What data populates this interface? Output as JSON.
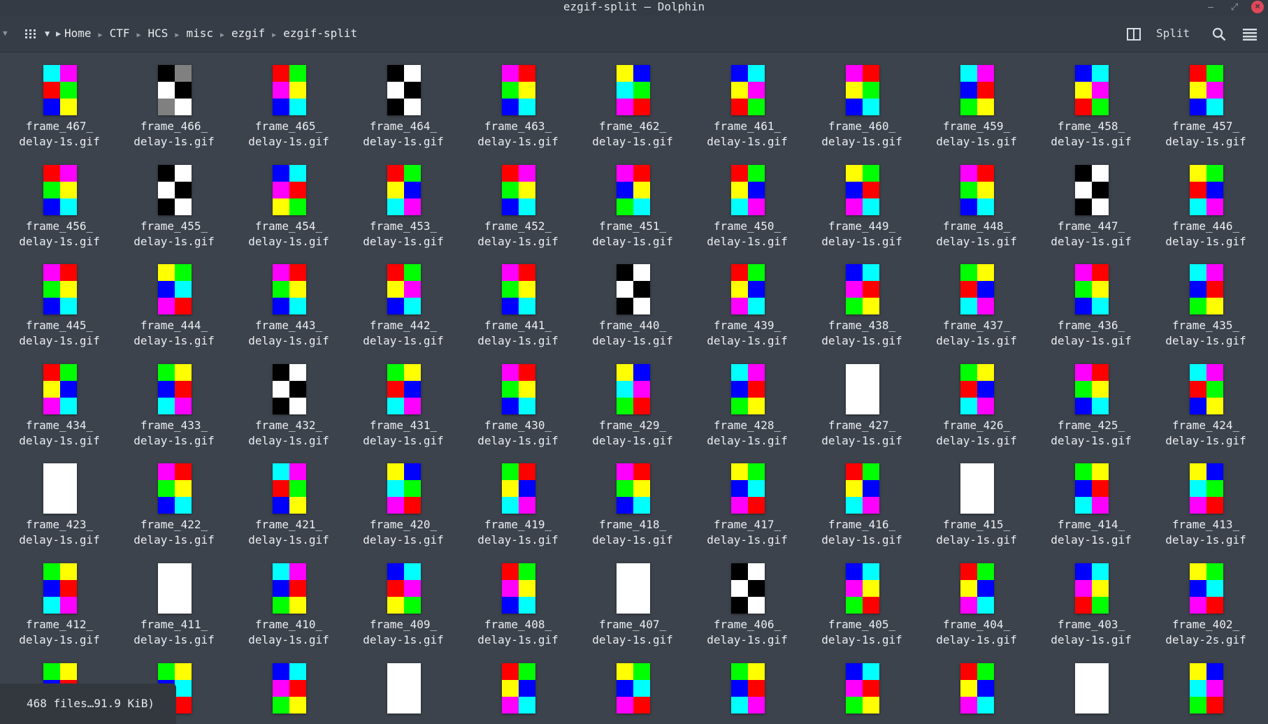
{
  "window": {
    "title": "ezgif-split — Dolphin"
  },
  "toolbar": {
    "breadcrumb": [
      "Home",
      "CTF",
      "HCS",
      "misc",
      "ezgif",
      "ezgif-split"
    ],
    "split_label": "Split"
  },
  "colors": {
    "R": "#ff0000",
    "G": "#00ff00",
    "B": "#0000ff",
    "Y": "#ffff00",
    "C": "#00ffff",
    "M": "#ff00ff",
    "K": "#000000",
    "W": "#ffffff",
    "E": "#808080"
  },
  "files": [
    {
      "l1": "frame_467_",
      "l2": "delay-1s.gif",
      "c": "CMRGBY"
    },
    {
      "l1": "frame_466_",
      "l2": "delay-1s.gif",
      "c": "KEWKEW"
    },
    {
      "l1": "frame_465_",
      "l2": "delay-1s.gif",
      "c": "RGMYBC"
    },
    {
      "l1": "frame_464_",
      "l2": "delay-1s.gif",
      "c": "KWWKKW"
    },
    {
      "l1": "frame_463_",
      "l2": "delay-1s.gif",
      "c": "MRGYBC"
    },
    {
      "l1": "frame_462_",
      "l2": "delay-1s.gif",
      "c": "YBCGMR"
    },
    {
      "l1": "frame_461_",
      "l2": "delay-1s.gif",
      "c": "BCYMRG"
    },
    {
      "l1": "frame_460_",
      "l2": "delay-1s.gif",
      "c": "MRYGBC"
    },
    {
      "l1": "frame_459_",
      "l2": "delay-1s.gif",
      "c": "CMBRGY"
    },
    {
      "l1": "frame_458_",
      "l2": "delay-1s.gif",
      "c": "BCYMRG"
    },
    {
      "l1": "frame_457_",
      "l2": "delay-1s.gif",
      "c": "RGYMBC"
    },
    {
      "l1": "frame_456_",
      "l2": "delay-1s.gif",
      "c": "RMGYBC"
    },
    {
      "l1": "frame_455_",
      "l2": "delay-1s.gif",
      "c": "KWWKKW"
    },
    {
      "l1": "frame_454_",
      "l2": "delay-1s.gif",
      "c": "BCMRYG"
    },
    {
      "l1": "frame_453_",
      "l2": "delay-1s.gif",
      "c": "RGYBCM"
    },
    {
      "l1": "frame_452_",
      "l2": "delay-1s.gif",
      "c": "RMGYBC"
    },
    {
      "l1": "frame_451_",
      "l2": "delay-1s.gif",
      "c": "MRBYGC"
    },
    {
      "l1": "frame_450_",
      "l2": "delay-1s.gif",
      "c": "RGYBCM"
    },
    {
      "l1": "frame_449_",
      "l2": "delay-1s.gif",
      "c": "YGBRMC"
    },
    {
      "l1": "frame_448_",
      "l2": "delay-1s.gif",
      "c": "MRGYBC"
    },
    {
      "l1": "frame_447_",
      "l2": "delay-1s.gif",
      "c": "KWWKKW"
    },
    {
      "l1": "frame_446_",
      "l2": "delay-1s.gif",
      "c": "YGRBCM"
    },
    {
      "l1": "frame_445_",
      "l2": "delay-1s.gif",
      "c": "MRGYBC"
    },
    {
      "l1": "frame_444_",
      "l2": "delay-1s.gif",
      "c": "YGBCMR"
    },
    {
      "l1": "frame_443_",
      "l2": "delay-1s.gif",
      "c": "MRGYBC"
    },
    {
      "l1": "frame_442_",
      "l2": "delay-1s.gif",
      "c": "RGYMBC"
    },
    {
      "l1": "frame_441_",
      "l2": "delay-1s.gif",
      "c": "MRGYBC"
    },
    {
      "l1": "frame_440_",
      "l2": "delay-1s.gif",
      "c": "KWWKKW"
    },
    {
      "l1": "frame_439_",
      "l2": "delay-1s.gif",
      "c": "RGYBMC"
    },
    {
      "l1": "frame_438_",
      "l2": "delay-1s.gif",
      "c": "BCMRGY"
    },
    {
      "l1": "frame_437_",
      "l2": "delay-1s.gif",
      "c": "GYRBCM"
    },
    {
      "l1": "frame_436_",
      "l2": "delay-1s.gif",
      "c": "MRGYBC"
    },
    {
      "l1": "frame_435_",
      "l2": "delay-1s.gif",
      "c": "CMBRGY"
    },
    {
      "l1": "frame_434_",
      "l2": "delay-1s.gif",
      "c": "RGYBMC"
    },
    {
      "l1": "frame_433_",
      "l2": "delay-1s.gif",
      "c": "GYBRCM"
    },
    {
      "l1": "frame_432_",
      "l2": "delay-1s.gif",
      "c": "KWWKKW"
    },
    {
      "l1": "frame_431_",
      "l2": "delay-1s.gif",
      "c": "GYRBCM"
    },
    {
      "l1": "frame_430_",
      "l2": "delay-1s.gif",
      "c": "MRGYBC"
    },
    {
      "l1": "frame_429_",
      "l2": "delay-1s.gif",
      "c": "YBCMGR"
    },
    {
      "l1": "frame_428_",
      "l2": "delay-1s.gif",
      "c": "CMBRGY"
    },
    {
      "l1": "frame_427_",
      "l2": "delay-1s.gif",
      "c": "WWWWWW"
    },
    {
      "l1": "frame_426_",
      "l2": "delay-1s.gif",
      "c": "GYRBCM"
    },
    {
      "l1": "frame_425_",
      "l2": "delay-1s.gif",
      "c": "MRGYBC"
    },
    {
      "l1": "frame_424_",
      "l2": "delay-1s.gif",
      "c": "CMRGBY"
    },
    {
      "l1": "frame_423_",
      "l2": "delay-1s.gif",
      "c": "WWWWWW"
    },
    {
      "l1": "frame_422_",
      "l2": "delay-1s.gif",
      "c": "MRGYBC"
    },
    {
      "l1": "frame_421_",
      "l2": "delay-1s.gif",
      "c": "CMRGBY"
    },
    {
      "l1": "frame_420_",
      "l2": "delay-1s.gif",
      "c": "YBCGMR"
    },
    {
      "l1": "frame_419_",
      "l2": "delay-1s.gif",
      "c": "GRYBCM"
    },
    {
      "l1": "frame_418_",
      "l2": "delay-1s.gif",
      "c": "MRGYBC"
    },
    {
      "l1": "frame_417_",
      "l2": "delay-1s.gif",
      "c": "YGBCMR"
    },
    {
      "l1": "frame_416_",
      "l2": "delay-1s.gif",
      "c": "RGYBCM"
    },
    {
      "l1": "frame_415_",
      "l2": "delay-1s.gif",
      "c": "WWWWWW"
    },
    {
      "l1": "frame_414_",
      "l2": "delay-1s.gif",
      "c": "GYBRCM"
    },
    {
      "l1": "frame_413_",
      "l2": "delay-1s.gif",
      "c": "YBCGMR"
    },
    {
      "l1": "frame_412_",
      "l2": "delay-1s.gif",
      "c": "GYBRCM"
    },
    {
      "l1": "frame_411_",
      "l2": "delay-1s.gif",
      "c": "WWWWWW"
    },
    {
      "l1": "frame_410_",
      "l2": "delay-1s.gif",
      "c": "CMBRGY"
    },
    {
      "l1": "frame_409_",
      "l2": "delay-1s.gif",
      "c": "BCRMYG"
    },
    {
      "l1": "frame_408_",
      "l2": "delay-1s.gif",
      "c": "RGMYBC"
    },
    {
      "l1": "frame_407_",
      "l2": "delay-1s.gif",
      "c": "WWWWWW"
    },
    {
      "l1": "frame_406_",
      "l2": "delay-1s.gif",
      "c": "KWWKKW"
    },
    {
      "l1": "frame_405_",
      "l2": "delay-1s.gif",
      "c": "BCMYGR"
    },
    {
      "l1": "frame_404_",
      "l2": "delay-1s.gif",
      "c": "RGYBMC"
    },
    {
      "l1": "frame_403_",
      "l2": "delay-1s.gif",
      "c": "BCMYRG"
    },
    {
      "l1": "frame_402_",
      "l2": "delay-2s.gif",
      "c": "YGBCMR"
    },
    {
      "l1": "",
      "l2": "",
      "c": "GYBRMC"
    },
    {
      "l1": "",
      "l2": "",
      "c": "GYBCMR"
    },
    {
      "l1": "",
      "l2": "",
      "c": "BCMRGY"
    },
    {
      "l1": "",
      "l2": "",
      "c": "WWWWWW"
    },
    {
      "l1": "",
      "l2": "",
      "c": "RGYBMC"
    },
    {
      "l1": "",
      "l2": "",
      "c": "YGBCMR"
    },
    {
      "l1": "",
      "l2": "",
      "c": "GYBRCM"
    },
    {
      "l1": "",
      "l2": "",
      "c": "BCMRGY"
    },
    {
      "l1": "",
      "l2": "",
      "c": "RGYBMC"
    },
    {
      "l1": "",
      "l2": "",
      "c": "WWWWWW"
    },
    {
      "l1": "",
      "l2": "",
      "c": "YBCMGR"
    }
  ],
  "status": {
    "text": "468 files…91.9 KiB)"
  }
}
